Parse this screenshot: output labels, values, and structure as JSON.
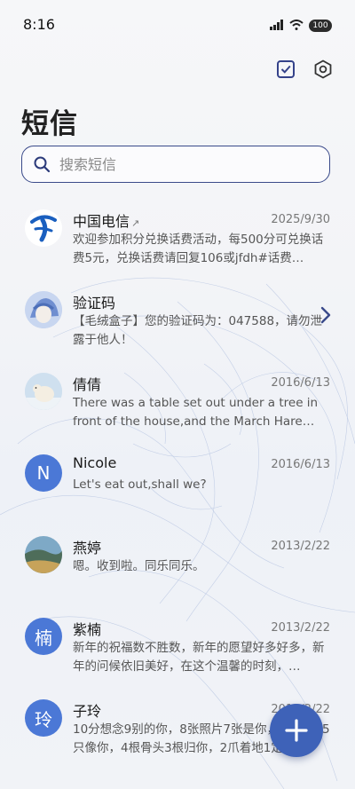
{
  "status": {
    "time": "8:16",
    "battery": "100"
  },
  "header": {
    "title": "短信"
  },
  "search": {
    "placeholder": "搜索短信"
  },
  "messages": [
    {
      "name": "中国电信",
      "name_suffix": "↗",
      "date": "2025/9/30",
      "snippet": "欢迎参加积分兑换话费活动，每500分可兑换话费5元，兑换话费请回复106或jfdh#话费…",
      "avatar": "china-telecom-logo"
    },
    {
      "name": "验证码",
      "date": "",
      "snippet": "【毛绒盒子】您的验证码为：047588，请勿泄露于他人！",
      "avatar": "anime-avatar"
    },
    {
      "name": "倩倩",
      "date": "2016/6/13",
      "snippet": "There was a table set out under a tree in front of the house,and the March Hare an…",
      "avatar": "polar-bear-photo"
    },
    {
      "name": "Nicole",
      "date": "2016/6/13",
      "snippet": "Let's eat out,shall we?",
      "avatar_letter": "N"
    },
    {
      "name": "燕婷",
      "date": "2013/2/22",
      "snippet": "嗯。收到啦。同乐同乐。",
      "avatar": "landscape-photo"
    },
    {
      "name": "紫楠",
      "date": "2013/2/22",
      "snippet": "新年的祝福数不胜数，新年的愿望好多好多，新年的问候依旧美好，在这个温馨的时刻，…",
      "avatar_letter": "楠"
    },
    {
      "name": "子玲",
      "date": "2013/2/22",
      "snippet": "10分想念9别的你，8张照片7张是你，6只小狗5只像你，4根骨头3根归你，2爪着地1定…",
      "avatar_letter": "玲"
    }
  ],
  "colors": {
    "accent": "#3e62b8",
    "avatar_letter_bg": "#4b78d6",
    "search_border": "#3a4a8a"
  }
}
